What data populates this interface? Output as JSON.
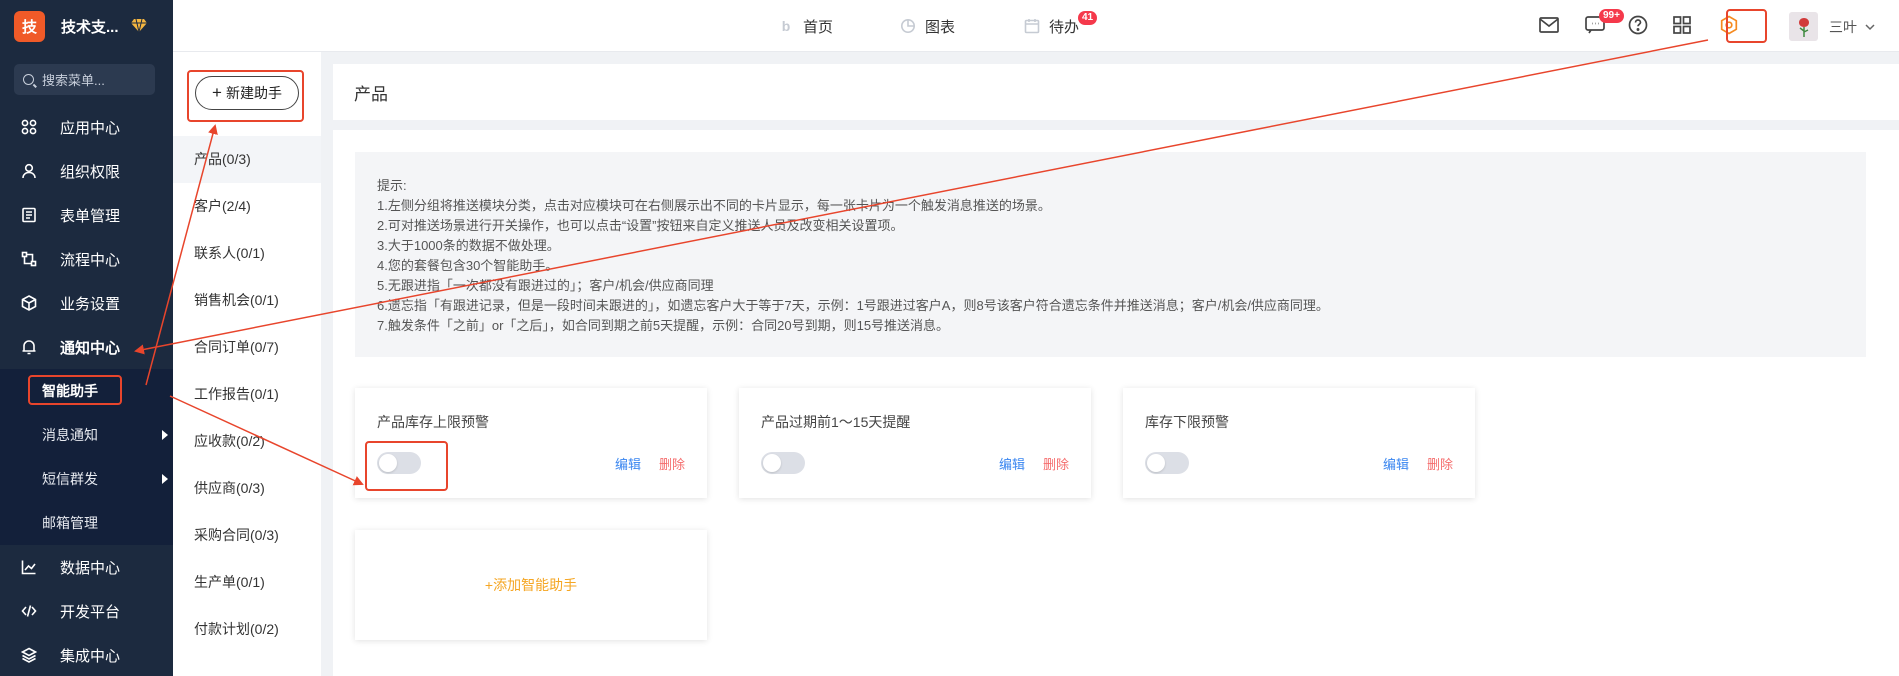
{
  "brand": {
    "logo_char": "技",
    "name": "技术支..."
  },
  "sidebar": {
    "search_placeholder": "搜索菜单...",
    "items": [
      {
        "label": "应用中心",
        "icon": "grid-icon"
      },
      {
        "label": "组织权限",
        "icon": "user-icon"
      },
      {
        "label": "表单管理",
        "icon": "form-icon"
      },
      {
        "label": "流程中心",
        "icon": "flow-icon"
      },
      {
        "label": "业务设置",
        "icon": "box-icon"
      },
      {
        "label": "通知中心",
        "icon": "bell-icon",
        "active": true
      }
    ],
    "sub_items": [
      {
        "label": "智能助手",
        "active": true
      },
      {
        "label": "消息通知",
        "has_children": true
      },
      {
        "label": "短信群发",
        "has_children": true
      },
      {
        "label": "邮箱管理"
      }
    ],
    "items_after": [
      {
        "label": "数据中心",
        "icon": "chart-icon"
      },
      {
        "label": "开发平台",
        "icon": "code-icon"
      },
      {
        "label": "集成中心",
        "icon": "layers-icon"
      }
    ]
  },
  "topbar": {
    "nav": [
      {
        "label": "首页",
        "icon": "home-icon"
      },
      {
        "label": "图表",
        "icon": "pie-icon"
      },
      {
        "label": "待办",
        "icon": "calendar-icon",
        "badge": "41"
      }
    ],
    "message_badge": "99+",
    "user_name": "三叶"
  },
  "groups": {
    "new_button": "新建助手",
    "items": [
      "产品(0/3)",
      "客户(2/4)",
      "联系人(0/1)",
      "销售机会(0/1)",
      "合同订单(0/7)",
      "工作报告(0/1)",
      "应收款(0/2)",
      "供应商(0/3)",
      "采购合同(0/3)",
      "生产单(0/1)",
      "付款计划(0/2)"
    ]
  },
  "main": {
    "title": "产品",
    "tips": [
      "提示:",
      "1.左侧分组将推送模块分类，点击对应模块可在右侧展示出不同的卡片显示，每一张卡片为一个触发消息推送的场景。",
      "2.可对推送场景进行开关操作，也可以点击“设置”按钮来自定义推送人员及改变相关设置项。",
      "3.大于1000条的数据不做处理。",
      "4.您的套餐包含30个智能助手。",
      "5.无跟进指「一次都没有跟进过的」；客户/机会/供应商同理",
      "6.遗忘指「有跟进记录，但是一段时间未跟进的」，如遗忘客户大于等于7天，示例：1号跟进过客户A，则8号该客户符合遗忘条件并推送消息；客户/机会/供应商同理。",
      "7.触发条件「之前」or「之后」，如合同到期之前5天提醒，示例：合同20号到期，则15号推送消息。"
    ],
    "cards": [
      {
        "title": "产品库存上限预警",
        "enabled": false,
        "edit": "编辑",
        "delete": "删除"
      },
      {
        "title": "产品过期前1～15天提醒",
        "enabled": false,
        "edit": "编辑",
        "delete": "删除"
      },
      {
        "title": "库存下限预警",
        "enabled": false,
        "edit": "编辑",
        "delete": "删除"
      }
    ],
    "add_card": "+添加智能助手"
  },
  "colors": {
    "sidebar_bg": "#1c2a3f",
    "accent_orange": "#f5a623",
    "annotation_red": "#e8452c",
    "link_blue": "#3a86f0",
    "delete_red": "#f56c6c",
    "badge_red": "#f5394b"
  }
}
